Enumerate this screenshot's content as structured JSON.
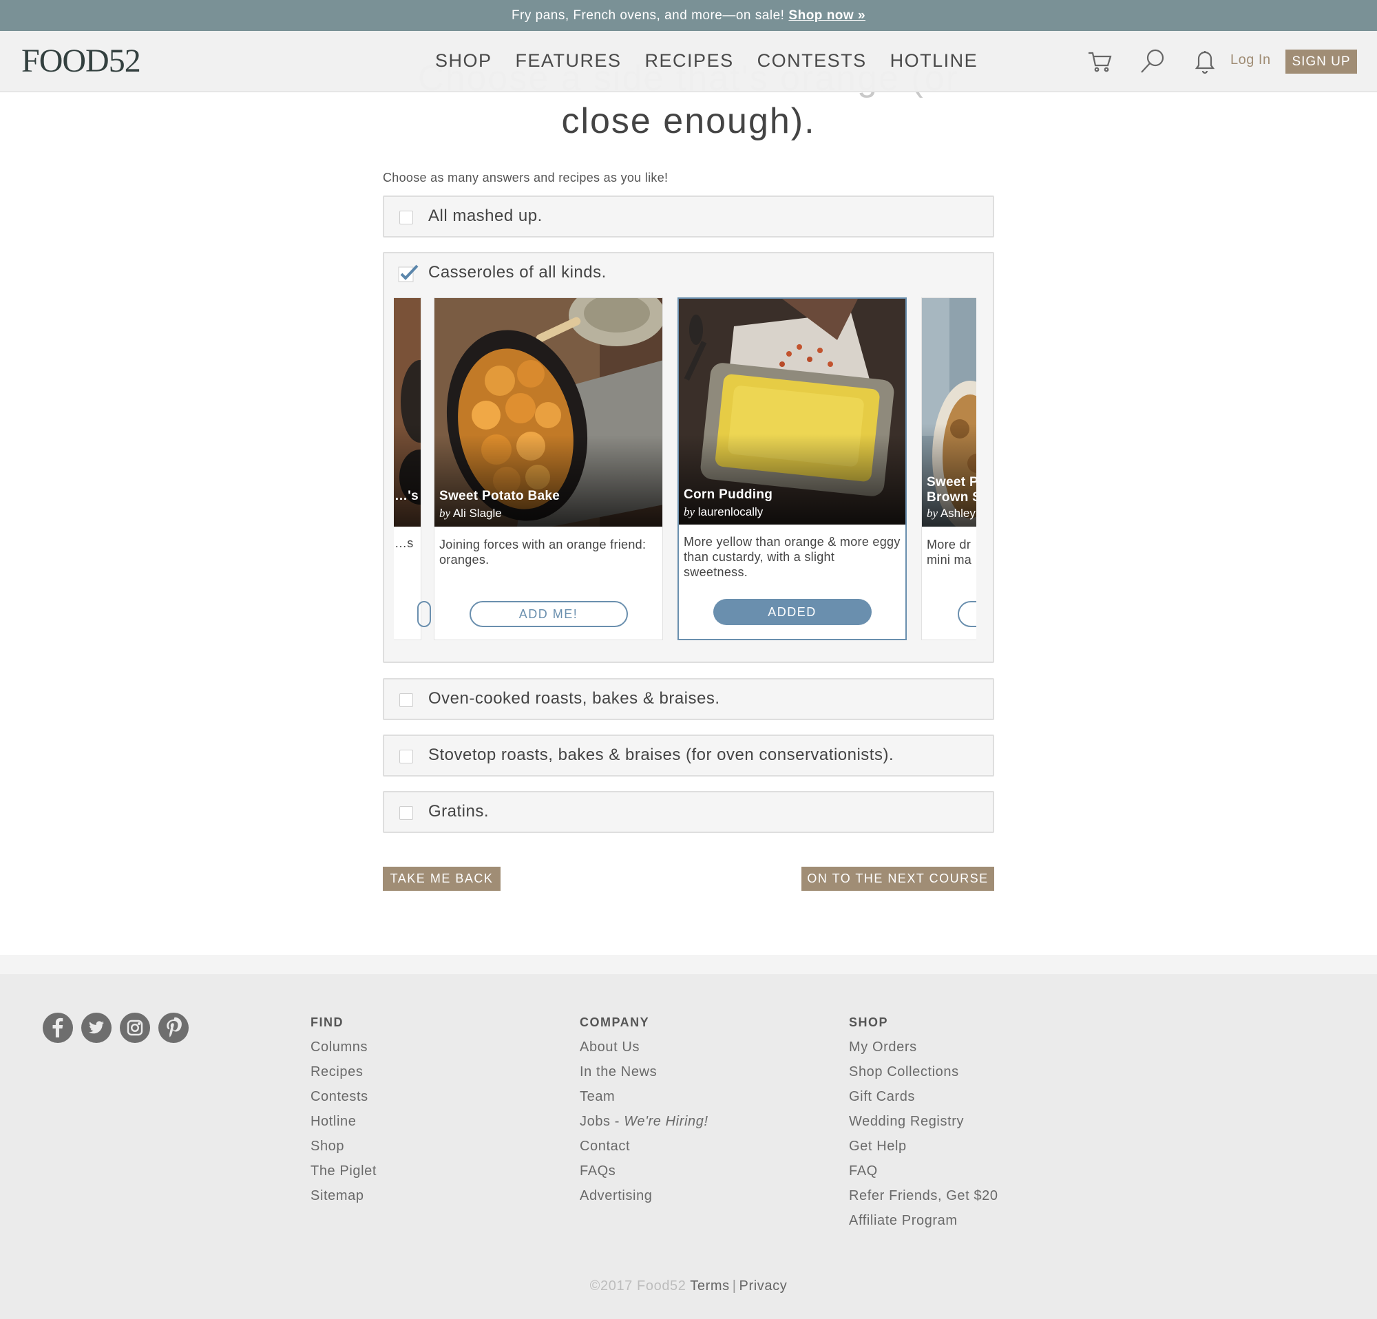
{
  "promo": {
    "text": "Fry pans, French ovens, and more—on sale!",
    "link": "Shop now »"
  },
  "header": {
    "logo": "FOOD52",
    "nav": [
      "SHOP",
      "FEATURES",
      "RECIPES",
      "CONTESTS",
      "HOTLINE"
    ],
    "icons": [
      "cart-icon",
      "search-icon",
      "bell-icon"
    ],
    "login": "Log In",
    "signup": "SIGN UP"
  },
  "page": {
    "title_line1": "Choose a side that's orange (or",
    "title_line2": "close enough).",
    "instructions": "Choose as many answers and recipes as you like!"
  },
  "options": [
    {
      "label": "All mashed up.",
      "checked": false
    },
    {
      "label": "Casseroles of all kinds.",
      "checked": true
    },
    {
      "label": "Oven-cooked roasts, bakes & braises.",
      "checked": false
    },
    {
      "label": "Stovetop roasts, bakes & braises (for oven conservationists).",
      "checked": false
    },
    {
      "label": "Gratins.",
      "checked": false
    }
  ],
  "cards": [
    {
      "title": "…'s",
      "by": "by",
      "author": "",
      "desc": "…s",
      "button": ""
    },
    {
      "title": "Sweet Potato Bake",
      "by": "by",
      "author": "Ali Slagle",
      "desc": "Joining forces with an orange friend: oranges.",
      "button": "ADD ME!",
      "state": "add"
    },
    {
      "title": "Corn Pudding",
      "by": "by",
      "author": "laurenlocally",
      "desc": "More yellow than orange & more eggy than custardy, with a slight sweetness.",
      "button": "ADDED",
      "state": "added"
    },
    {
      "title": "Sweet P",
      "title2": "Brown S",
      "by": "by",
      "author": "Ashley",
      "desc": "More dr mini ma",
      "button": ""
    }
  ],
  "buttons": {
    "back": "TAKE ME BACK",
    "next": "ON TO THE NEXT COURSE"
  },
  "footer": {
    "social": [
      "facebook-icon",
      "twitter-icon",
      "instagram-icon",
      "pinterest-icon"
    ],
    "find": {
      "heading": "FIND",
      "items": [
        "Columns",
        "Recipes",
        "Contests",
        "Hotline",
        "Shop",
        "The Piglet",
        "Sitemap"
      ]
    },
    "company": {
      "heading": "COMPANY",
      "items": [
        "About Us",
        "In the News",
        "Team",
        "Jobs - ",
        "Contact",
        "FAQs",
        "Advertising"
      ],
      "hiring": "We're Hiring!"
    },
    "shop": {
      "heading": "SHOP",
      "items": [
        "My Orders",
        "Shop Collections",
        "Gift Cards",
        "Wedding Registry",
        "Get Help",
        "FAQ",
        "Refer Friends, Get $20",
        "Affiliate Program"
      ]
    },
    "copyright": "©2017 Food52",
    "terms": "Terms",
    "privacy": "Privacy"
  },
  "colors": {
    "accent": "#6a8fae",
    "brand_tan": "#a08d75",
    "promo_bg": "#7a9196"
  }
}
